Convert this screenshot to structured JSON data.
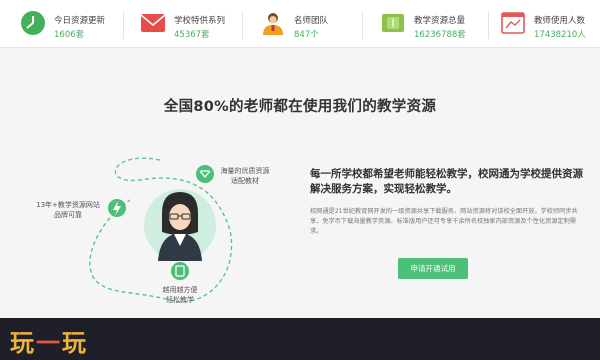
{
  "stats": [
    {
      "label": "今日资源更新",
      "value": "1606套",
      "icon": "clock-icon",
      "color": "#43b15b"
    },
    {
      "label": "学校特供系列",
      "value": "45367套",
      "icon": "envelope-icon",
      "color": "#e74c4c"
    },
    {
      "label": "名师团队",
      "value": "847个",
      "icon": "teacher-icon",
      "color": "#f0a020"
    },
    {
      "label": "教学资源总量",
      "value": "16236788套",
      "icon": "document-icon",
      "color": "#8bc34a"
    },
    {
      "label": "教师使用人数",
      "value": "17438210人",
      "icon": "window-icon",
      "color": "#e05a5a"
    }
  ],
  "headline": "全国80%的老师都在使用我们的教学资源",
  "diagram": {
    "left_label": "13年+教学资源网站\n品牌可靠",
    "top_label": "海量的优质资源\n适配教材",
    "bottom_label": "越用越方便\n轻松教学"
  },
  "promo": {
    "title": "每一所学校都希望老师能轻松教学，校网通为学校提供资源解决服务方案，实现轻松教学。",
    "description": "校网通是21世纪教育网开发的一级资源共享下载服务、网站资源将对该校全面开放，学校师同步共享、免学币下载海量教学资源。标准版用户还可专享千余所名校独家内部资源及个性化资源定制需求。",
    "cta_label": "申请开通试用"
  },
  "watermark": {
    "text_a": "玩",
    "text_b": "一",
    "text_c": "玩"
  }
}
